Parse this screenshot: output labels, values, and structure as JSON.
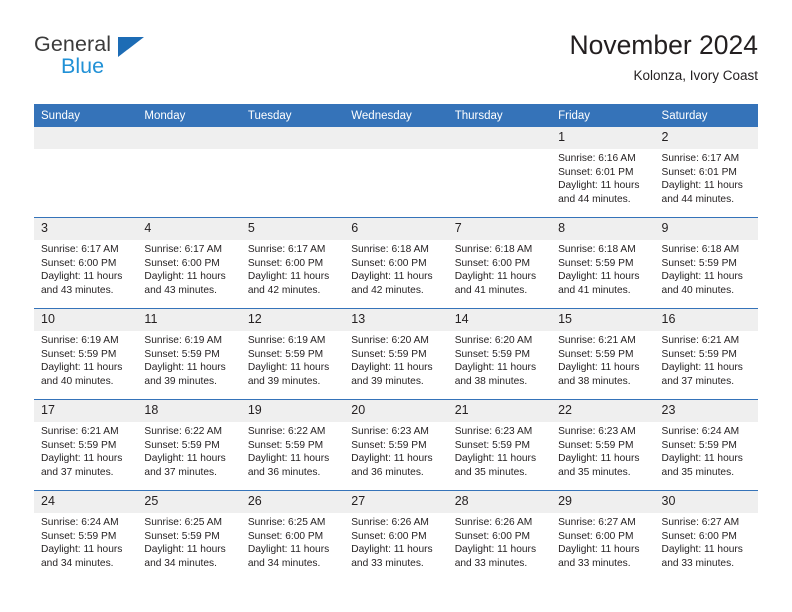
{
  "brand": {
    "name_part1": "General",
    "name_part2": "Blue",
    "primary_color": "#3573b9",
    "accent_color": "#2191d6"
  },
  "header": {
    "title": "November 2024",
    "subtitle": "Kolonza, Ivory Coast"
  },
  "weekday_headers": [
    "Sunday",
    "Monday",
    "Tuesday",
    "Wednesday",
    "Thursday",
    "Friday",
    "Saturday"
  ],
  "weeks": [
    [
      {
        "day": "",
        "lines": []
      },
      {
        "day": "",
        "lines": []
      },
      {
        "day": "",
        "lines": []
      },
      {
        "day": "",
        "lines": []
      },
      {
        "day": "",
        "lines": []
      },
      {
        "day": "1",
        "lines": [
          "Sunrise: 6:16 AM",
          "Sunset: 6:01 PM",
          "Daylight: 11 hours",
          "and 44 minutes."
        ]
      },
      {
        "day": "2",
        "lines": [
          "Sunrise: 6:17 AM",
          "Sunset: 6:01 PM",
          "Daylight: 11 hours",
          "and 44 minutes."
        ]
      }
    ],
    [
      {
        "day": "3",
        "lines": [
          "Sunrise: 6:17 AM",
          "Sunset: 6:00 PM",
          "Daylight: 11 hours",
          "and 43 minutes."
        ]
      },
      {
        "day": "4",
        "lines": [
          "Sunrise: 6:17 AM",
          "Sunset: 6:00 PM",
          "Daylight: 11 hours",
          "and 43 minutes."
        ]
      },
      {
        "day": "5",
        "lines": [
          "Sunrise: 6:17 AM",
          "Sunset: 6:00 PM",
          "Daylight: 11 hours",
          "and 42 minutes."
        ]
      },
      {
        "day": "6",
        "lines": [
          "Sunrise: 6:18 AM",
          "Sunset: 6:00 PM",
          "Daylight: 11 hours",
          "and 42 minutes."
        ]
      },
      {
        "day": "7",
        "lines": [
          "Sunrise: 6:18 AM",
          "Sunset: 6:00 PM",
          "Daylight: 11 hours",
          "and 41 minutes."
        ]
      },
      {
        "day": "8",
        "lines": [
          "Sunrise: 6:18 AM",
          "Sunset: 5:59 PM",
          "Daylight: 11 hours",
          "and 41 minutes."
        ]
      },
      {
        "day": "9",
        "lines": [
          "Sunrise: 6:18 AM",
          "Sunset: 5:59 PM",
          "Daylight: 11 hours",
          "and 40 minutes."
        ]
      }
    ],
    [
      {
        "day": "10",
        "lines": [
          "Sunrise: 6:19 AM",
          "Sunset: 5:59 PM",
          "Daylight: 11 hours",
          "and 40 minutes."
        ]
      },
      {
        "day": "11",
        "lines": [
          "Sunrise: 6:19 AM",
          "Sunset: 5:59 PM",
          "Daylight: 11 hours",
          "and 39 minutes."
        ]
      },
      {
        "day": "12",
        "lines": [
          "Sunrise: 6:19 AM",
          "Sunset: 5:59 PM",
          "Daylight: 11 hours",
          "and 39 minutes."
        ]
      },
      {
        "day": "13",
        "lines": [
          "Sunrise: 6:20 AM",
          "Sunset: 5:59 PM",
          "Daylight: 11 hours",
          "and 39 minutes."
        ]
      },
      {
        "day": "14",
        "lines": [
          "Sunrise: 6:20 AM",
          "Sunset: 5:59 PM",
          "Daylight: 11 hours",
          "and 38 minutes."
        ]
      },
      {
        "day": "15",
        "lines": [
          "Sunrise: 6:21 AM",
          "Sunset: 5:59 PM",
          "Daylight: 11 hours",
          "and 38 minutes."
        ]
      },
      {
        "day": "16",
        "lines": [
          "Sunrise: 6:21 AM",
          "Sunset: 5:59 PM",
          "Daylight: 11 hours",
          "and 37 minutes."
        ]
      }
    ],
    [
      {
        "day": "17",
        "lines": [
          "Sunrise: 6:21 AM",
          "Sunset: 5:59 PM",
          "Daylight: 11 hours",
          "and 37 minutes."
        ]
      },
      {
        "day": "18",
        "lines": [
          "Sunrise: 6:22 AM",
          "Sunset: 5:59 PM",
          "Daylight: 11 hours",
          "and 37 minutes."
        ]
      },
      {
        "day": "19",
        "lines": [
          "Sunrise: 6:22 AM",
          "Sunset: 5:59 PM",
          "Daylight: 11 hours",
          "and 36 minutes."
        ]
      },
      {
        "day": "20",
        "lines": [
          "Sunrise: 6:23 AM",
          "Sunset: 5:59 PM",
          "Daylight: 11 hours",
          "and 36 minutes."
        ]
      },
      {
        "day": "21",
        "lines": [
          "Sunrise: 6:23 AM",
          "Sunset: 5:59 PM",
          "Daylight: 11 hours",
          "and 35 minutes."
        ]
      },
      {
        "day": "22",
        "lines": [
          "Sunrise: 6:23 AM",
          "Sunset: 5:59 PM",
          "Daylight: 11 hours",
          "and 35 minutes."
        ]
      },
      {
        "day": "23",
        "lines": [
          "Sunrise: 6:24 AM",
          "Sunset: 5:59 PM",
          "Daylight: 11 hours",
          "and 35 minutes."
        ]
      }
    ],
    [
      {
        "day": "24",
        "lines": [
          "Sunrise: 6:24 AM",
          "Sunset: 5:59 PM",
          "Daylight: 11 hours",
          "and 34 minutes."
        ]
      },
      {
        "day": "25",
        "lines": [
          "Sunrise: 6:25 AM",
          "Sunset: 5:59 PM",
          "Daylight: 11 hours",
          "and 34 minutes."
        ]
      },
      {
        "day": "26",
        "lines": [
          "Sunrise: 6:25 AM",
          "Sunset: 6:00 PM",
          "Daylight: 11 hours",
          "and 34 minutes."
        ]
      },
      {
        "day": "27",
        "lines": [
          "Sunrise: 6:26 AM",
          "Sunset: 6:00 PM",
          "Daylight: 11 hours",
          "and 33 minutes."
        ]
      },
      {
        "day": "28",
        "lines": [
          "Sunrise: 6:26 AM",
          "Sunset: 6:00 PM",
          "Daylight: 11 hours",
          "and 33 minutes."
        ]
      },
      {
        "day": "29",
        "lines": [
          "Sunrise: 6:27 AM",
          "Sunset: 6:00 PM",
          "Daylight: 11 hours",
          "and 33 minutes."
        ]
      },
      {
        "day": "30",
        "lines": [
          "Sunrise: 6:27 AM",
          "Sunset: 6:00 PM",
          "Daylight: 11 hours",
          "and 33 minutes."
        ]
      }
    ]
  ]
}
